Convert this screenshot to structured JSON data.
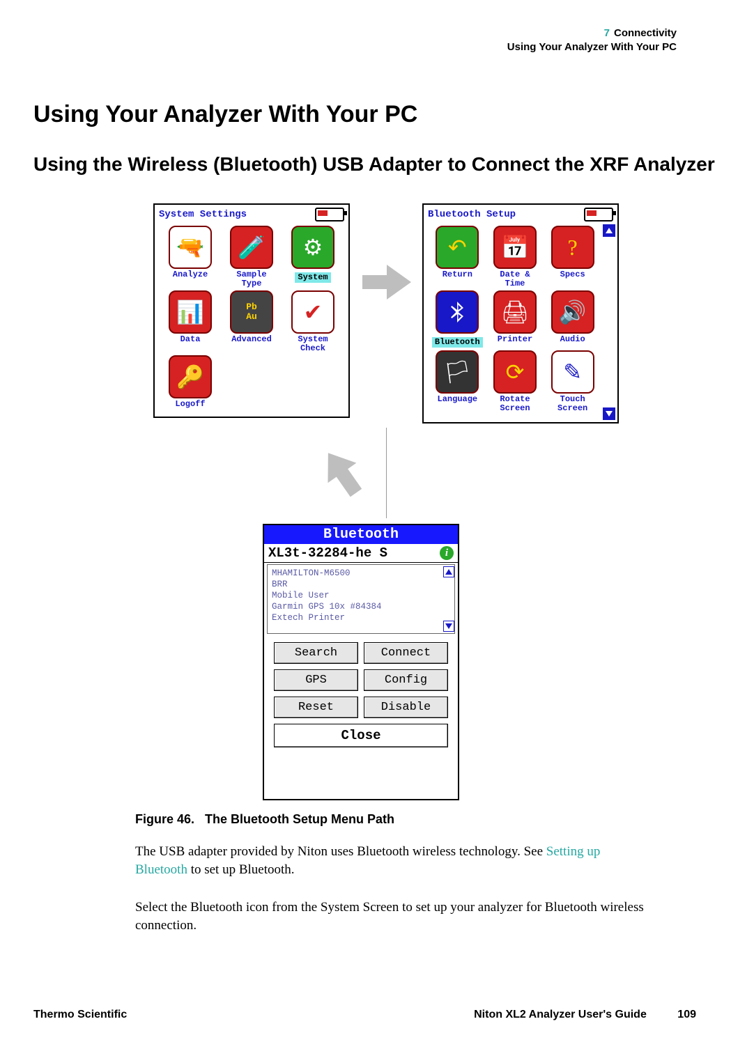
{
  "header": {
    "chapter_num": "7",
    "chapter_title": "Connectivity",
    "section_line": "Using Your Analyzer With Your PC"
  },
  "h1": "Using Your Analyzer With Your PC",
  "h2": "Using the Wireless (Bluetooth) USB Adapter to Connect the XRF Analyzer",
  "screen1": {
    "title": "System Settings",
    "icons": [
      {
        "label": "Analyze",
        "glyph": "🔫",
        "bg": "#fff",
        "fg": "#555"
      },
      {
        "label": "Sample\nType",
        "glyph": "🧪",
        "bg": "#d62222",
        "fg": "#fff"
      },
      {
        "label": "System",
        "glyph": "⚙",
        "bg": "#2aa82a",
        "fg": "#fff",
        "highlight": true
      },
      {
        "label": "Data",
        "glyph": "📊",
        "bg": "#d62222",
        "fg": "#fff"
      },
      {
        "label": "Advanced",
        "glyph": "Pb\nAu",
        "bg": "#444",
        "fg": "#ffd400",
        "mono": true
      },
      {
        "label": "System\nCheck",
        "glyph": "✔",
        "bg": "#fff",
        "fg": "#d62222"
      },
      {
        "label": "Logoff",
        "glyph": "🔑",
        "bg": "#d62222",
        "fg": "#ff7b00"
      }
    ]
  },
  "screen2": {
    "title": "Bluetooth Setup",
    "icons": [
      {
        "label": "Return",
        "glyph": "↶",
        "bg": "#2aa82a",
        "fg": "#ffd400"
      },
      {
        "label": "Date &\nTime",
        "glyph": "📅",
        "bg": "#d62222",
        "fg": "#fff"
      },
      {
        "label": "Specs",
        "glyph": "?",
        "bg": "#d62222",
        "fg": "#ffd400"
      },
      {
        "label": "Bluetooth",
        "glyph": "bt",
        "bg": "#1818c8",
        "fg": "#fff",
        "highlight": true
      },
      {
        "label": "Printer",
        "glyph": "🖨",
        "bg": "#d62222",
        "fg": "#fff"
      },
      {
        "label": "Audio",
        "glyph": "🔊",
        "bg": "#d62222",
        "fg": "#fff"
      },
      {
        "label": "Language",
        "glyph": "🏳",
        "bg": "#333",
        "fg": "#fff"
      },
      {
        "label": "Rotate\nScreen",
        "glyph": "⟳",
        "bg": "#d62222",
        "fg": "#ffd400"
      },
      {
        "label": "Touch\nScreen",
        "glyph": "✎",
        "bg": "#fff",
        "fg": "#1818c8"
      }
    ]
  },
  "screen3": {
    "header": "Bluetooth",
    "device_name": "XL3t-32284-he S",
    "list": [
      "MHAMILTON-M6500",
      "BRR",
      "Mobile User",
      "Garmin GPS 10x #84384",
      "Extech Printer"
    ],
    "buttons": {
      "search": "Search",
      "connect": "Connect",
      "gps": "GPS",
      "config": "Config",
      "reset": "Reset",
      "disable": "Disable",
      "close": "Close"
    }
  },
  "figure": {
    "label": "Figure 46.",
    "title": "The Bluetooth Setup Menu Path"
  },
  "para1_a": "The USB adapter provided by Niton uses Bluetooth wireless technology. See ",
  "para1_link": "Setting up Bluetooth",
  "para1_b": " to set up Bluetooth.",
  "para2": "Select the Bluetooth icon from the System Screen to set up your analyzer for Bluetooth wireless connection.",
  "footer": {
    "left": "Thermo Scientific",
    "guide": "Niton XL2 Analyzer User's Guide",
    "page": "109"
  }
}
